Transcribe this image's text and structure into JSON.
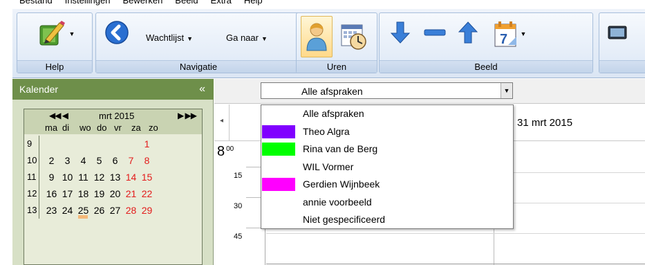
{
  "menu": {
    "items": [
      "Bestand",
      "Instellingen",
      "Bewerken",
      "Beeld",
      "Extra",
      "Help"
    ]
  },
  "ribbon": {
    "groups": {
      "help": {
        "label": "Help"
      },
      "navigatie": {
        "label": "Navigatie",
        "wachtlijst": "Wachtlijst",
        "ganaar": "Ga naar"
      },
      "uren": {
        "label": "Uren"
      },
      "beeld": {
        "label": "Beeld"
      }
    }
  },
  "calendar": {
    "header": "Kalender",
    "collapse_glyph": "«",
    "nav_prev": "◀◀ ◀",
    "nav_next": "▶ ▶▶",
    "month": "mrt 2015",
    "weekdays": [
      "ma",
      "di",
      "wo",
      "do",
      "vr",
      "za",
      "zo"
    ],
    "weeks": [
      {
        "num": "9",
        "days": [
          "",
          "",
          "",
          "",
          "",
          "",
          "1"
        ]
      },
      {
        "num": "10",
        "days": [
          "2",
          "3",
          "4",
          "5",
          "6",
          "7",
          "8"
        ]
      },
      {
        "num": "11",
        "days": [
          "9",
          "10",
          "11",
          "12",
          "13",
          "14",
          "15"
        ]
      },
      {
        "num": "12",
        "days": [
          "16",
          "17",
          "18",
          "19",
          "20",
          "21",
          "22"
        ]
      },
      {
        "num": "13",
        "days": [
          "23",
          "24",
          "25",
          "26",
          "27",
          "28",
          "29"
        ]
      }
    ]
  },
  "filter": {
    "selected": "Alle afspraken"
  },
  "day_header": {
    "date": "31 mrt 2015"
  },
  "times": {
    "hour": "8",
    "hour_min": "00",
    "quarters": [
      "15",
      "30",
      "45"
    ]
  },
  "dropdown": {
    "options": [
      {
        "label": "Alle afspraken",
        "color": ""
      },
      {
        "label": "Theo  Algra",
        "color": "#8000ff"
      },
      {
        "label": "Rina van de Berg",
        "color": "#00ff00"
      },
      {
        "label": "WIL Vormer",
        "color": ""
      },
      {
        "label": "Gerdien Wijnbeek",
        "color": "#ff00ff"
      },
      {
        "label": "annie voorbeeld",
        "color": ""
      },
      {
        "label": "Niet gespecificeerd",
        "color": ""
      }
    ]
  },
  "colors": {
    "calendar_header": "#6e8f4a",
    "weekend_text": "#e31b1b",
    "today_marker": "#f5b878"
  }
}
